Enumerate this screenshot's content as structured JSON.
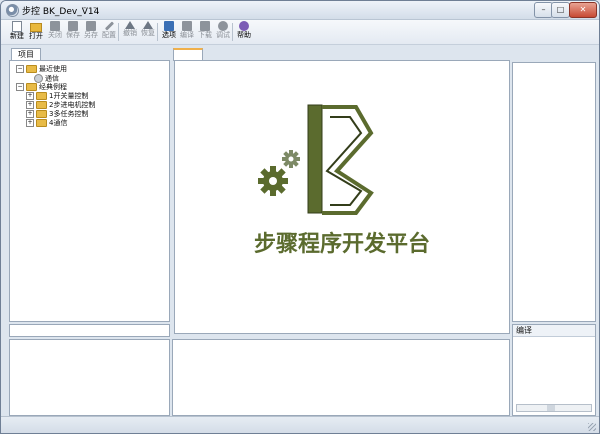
{
  "window": {
    "title": "步控  BK_Dev_V14",
    "title_menu": "- -",
    "controls": {
      "minimize": "–",
      "maximize": "□",
      "close": "✕"
    }
  },
  "toolbar": {
    "items": [
      {
        "label": "新建",
        "icon": "new-file-icon",
        "enabled": true
      },
      {
        "label": "打开",
        "icon": "open-folder-icon",
        "enabled": true
      },
      {
        "label": "关闭",
        "icon": "close-doc-icon",
        "enabled": false
      },
      {
        "label": "保存",
        "icon": "save-icon",
        "enabled": false
      },
      {
        "label": "另存",
        "icon": "save-as-icon",
        "enabled": false
      },
      {
        "label": "配置",
        "icon": "wrench-icon",
        "enabled": false
      },
      {
        "label": "撤销",
        "icon": "undo-icon",
        "enabled": false
      },
      {
        "label": "恢复",
        "icon": "redo-icon",
        "enabled": false
      },
      {
        "label": "选项",
        "icon": "options-icon",
        "enabled": true
      },
      {
        "label": "编译",
        "icon": "compile-icon",
        "enabled": false
      },
      {
        "label": "下载",
        "icon": "download-icon",
        "enabled": false
      },
      {
        "label": "调试",
        "icon": "debug-icon",
        "enabled": false
      },
      {
        "label": "帮助",
        "icon": "help-icon",
        "enabled": true
      }
    ]
  },
  "project_panel": {
    "tab": "项目",
    "tree": [
      {
        "label": "最近使用",
        "level": 0,
        "type": "folder",
        "expanded": true
      },
      {
        "label": "通信",
        "level": 1,
        "type": "leaf"
      },
      {
        "label": "经典例程",
        "level": 0,
        "type": "folder",
        "expanded": true
      },
      {
        "label": "1开关量控制",
        "level": 1,
        "type": "folder",
        "expanded": false
      },
      {
        "label": "2步进电机控制",
        "level": 1,
        "type": "folder",
        "expanded": false
      },
      {
        "label": "3多任务控制",
        "level": 1,
        "type": "folder",
        "expanded": false
      },
      {
        "label": "4通信",
        "level": 1,
        "type": "folder",
        "expanded": false
      }
    ]
  },
  "editor": {
    "logo_letter": "B",
    "slogan": "步骤程序开发平台",
    "colors": {
      "logo_green": "#5b6b2e",
      "logo_dark": "#333d1a"
    }
  },
  "compile_panel": {
    "title": "编译"
  },
  "colors": {
    "chrome": "#dde5ee",
    "border": "#9aa8b9"
  }
}
